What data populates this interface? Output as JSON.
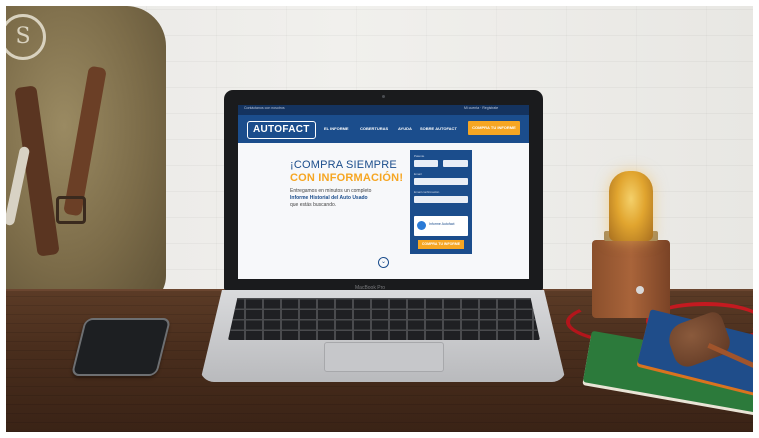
{
  "website": {
    "topbar_left": "Contáctanos con nosotros",
    "topbar_right": "Mi cuenta  ·  Registrate",
    "logo": "AUTOFACT",
    "nav": [
      "EL INFORME",
      "COBERTURAS",
      "AYUDA",
      "SOBRE AUTOFACT"
    ],
    "nav_button": "COMPRA TU INFORME",
    "headline_1": "¡COMPRA SIEMPRE",
    "headline_2": "CON INFORMACIÓN!",
    "body_1": "Entregamos en minutos un completo",
    "body_2": "Informe Historial del Auto Usado",
    "body_3": "que estás buscando.",
    "form_labels": [
      "Patente",
      "Email",
      "Email confirmación"
    ],
    "form_card": "Informe Autofact",
    "form_button": "COMPRA TU INFORME",
    "scroll_glyph": "⌄"
  },
  "laptop": {
    "brand": "MacBook Pro"
  },
  "bag_mark": "S"
}
